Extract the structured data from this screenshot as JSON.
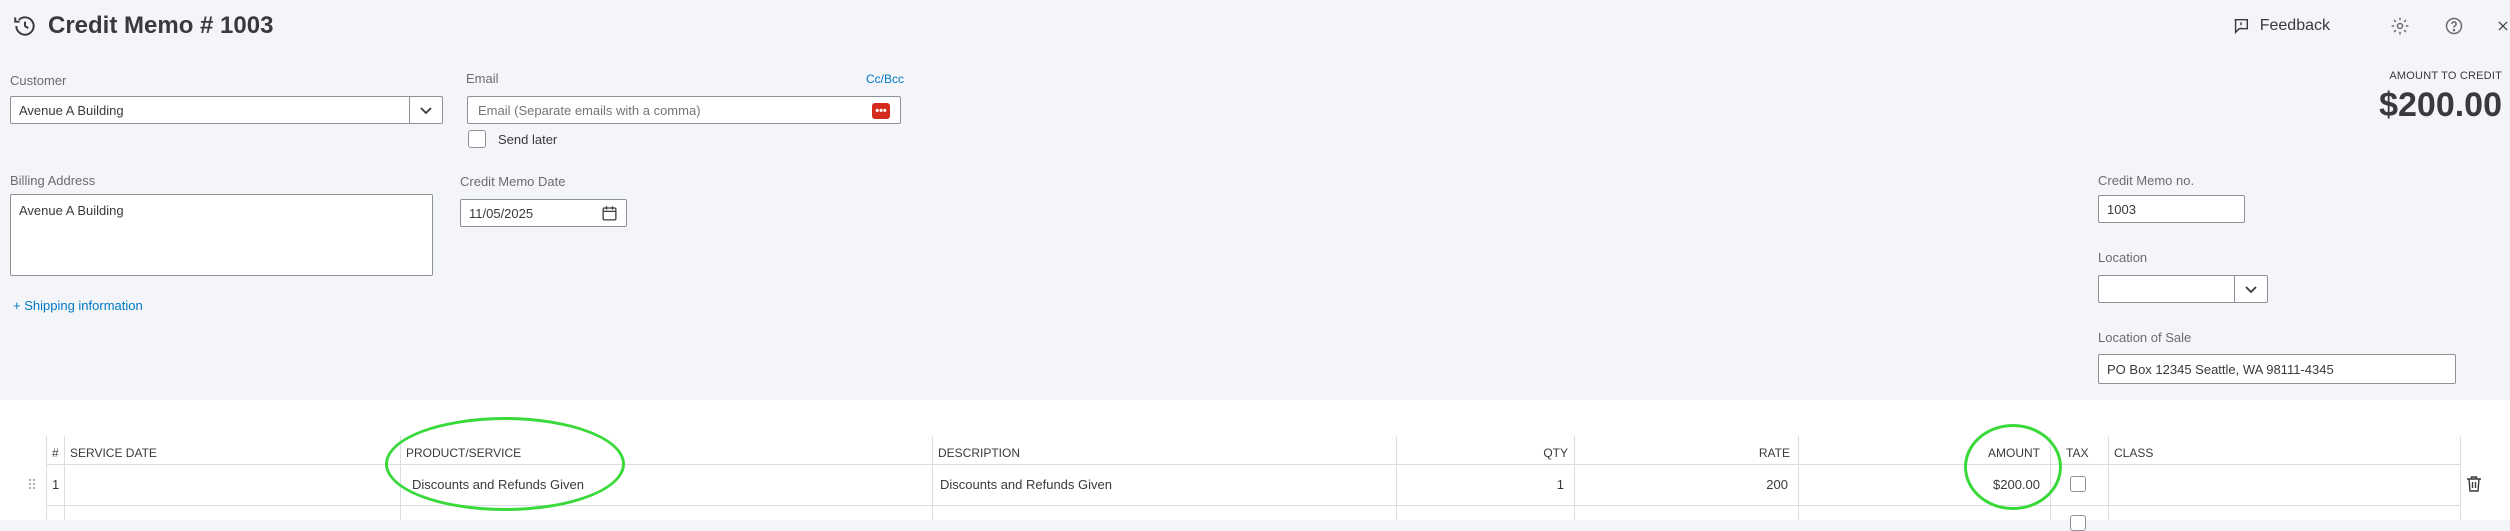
{
  "header": {
    "title": "Credit Memo # 1003",
    "feedback_label": "Feedback"
  },
  "customer": {
    "label": "Customer",
    "value": "Avenue A Building"
  },
  "email": {
    "label": "Email",
    "ccbcc": "Cc/Bcc",
    "placeholder": "Email (Separate emails with a comma)",
    "send_later": "Send later"
  },
  "amount": {
    "label": "AMOUNT TO CREDIT",
    "value": "$200.00"
  },
  "billing": {
    "label": "Billing Address",
    "value": "Avenue A Building"
  },
  "memo_date": {
    "label": "Credit Memo Date",
    "value": "11/05/2025"
  },
  "shipping_link": "+ Shipping information",
  "memo_no": {
    "label": "Credit Memo no.",
    "value": "1003"
  },
  "location": {
    "label": "Location",
    "value": ""
  },
  "location_of_sale": {
    "label": "Location of Sale",
    "value": "PO Box 12345 Seattle, WA 98111-4345"
  },
  "table": {
    "headers": {
      "num": "#",
      "service_date": "SERVICE DATE",
      "product": "PRODUCT/SERVICE",
      "description": "DESCRIPTION",
      "qty": "QTY",
      "rate": "RATE",
      "amount": "AMOUNT",
      "tax": "TAX",
      "class": "CLASS"
    },
    "rows": [
      {
        "num": "1",
        "service_date": "",
        "product": "Discounts and Refunds Given",
        "description": "Discounts and Refunds Given",
        "qty": "1",
        "rate": "200",
        "amount": "$200.00"
      }
    ]
  },
  "colors": {
    "accent": "#0077c5",
    "highlight": "#3ad93a",
    "email_icon": "#d52b1e"
  }
}
